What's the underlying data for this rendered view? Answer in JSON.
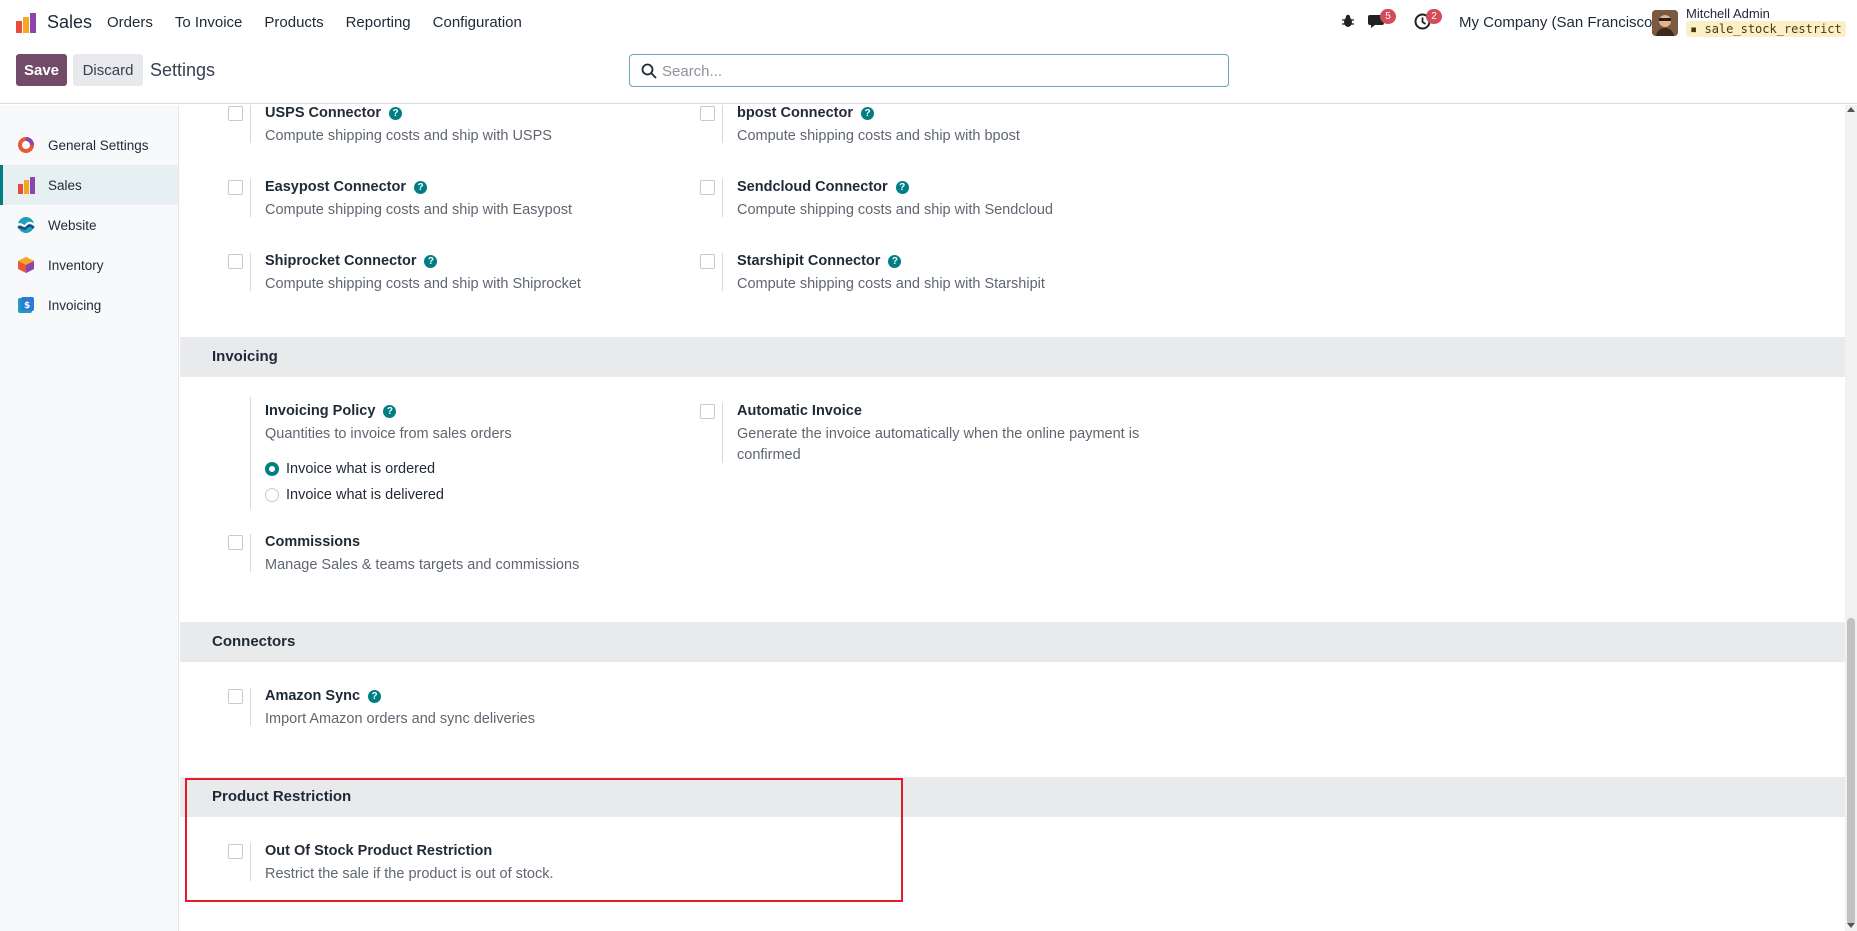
{
  "navbar": {
    "app_name": "Sales",
    "menu": [
      "Orders",
      "To Invoice",
      "Products",
      "Reporting",
      "Configuration"
    ],
    "messages_badge": "5",
    "activities_badge": "2",
    "company": "My Company (San Francisco)",
    "user_name": "Mitchell Admin",
    "db_name": "sale_stock_restrict"
  },
  "control": {
    "save_label": "Save",
    "discard_label": "Discard",
    "breadcrumb": "Settings",
    "search_placeholder": "Search..."
  },
  "sidebar": {
    "items": [
      {
        "label": "General Settings",
        "icon": "general-settings-icon"
      },
      {
        "label": "Sales",
        "icon": "sales-icon",
        "active": true
      },
      {
        "label": "Website",
        "icon": "website-icon"
      },
      {
        "label": "Inventory",
        "icon": "inventory-icon"
      },
      {
        "label": "Invoicing",
        "icon": "invoicing-icon"
      }
    ]
  },
  "shipping": {
    "usps": {
      "title": "USPS Connector",
      "desc": "Compute shipping costs and ship with USPS"
    },
    "bpost": {
      "title": "bpost Connector",
      "desc": "Compute shipping costs and ship with bpost"
    },
    "easypost": {
      "title": "Easypost Connector",
      "desc": "Compute shipping costs and ship with Easypost"
    },
    "sendcloud": {
      "title": "Sendcloud Connector",
      "desc": "Compute shipping costs and ship with Sendcloud"
    },
    "shiprocket": {
      "title": "Shiprocket Connector",
      "desc": "Compute shipping costs and ship with Shiprocket"
    },
    "starshipit": {
      "title": "Starshipit Connector",
      "desc": "Compute shipping costs and ship with Starshipit"
    }
  },
  "invoicing": {
    "heading": "Invoicing",
    "policy_title": "Invoicing Policy",
    "policy_desc": "Quantities to invoice from sales orders",
    "option_ordered": "Invoice what is ordered",
    "option_delivered": "Invoice what is delivered",
    "selected_option": "Invoice what is ordered",
    "auto_title": "Automatic Invoice",
    "auto_desc_1": "Generate the invoice automatically when the online payment is",
    "auto_desc_2": "confirmed",
    "commissions_title": "Commissions",
    "commissions_desc": "Manage Sales & teams targets and commissions"
  },
  "connectors": {
    "heading": "Connectors",
    "amazon_title": "Amazon Sync",
    "amazon_desc": "Import Amazon orders and sync deliveries"
  },
  "product_restriction": {
    "heading": "Product Restriction",
    "title": "Out Of Stock Product Restriction",
    "desc": "Restrict the sale if the product is out of stock."
  },
  "colors": {
    "brand": "#714b67",
    "accent": "#017e84",
    "highlight": "#e01e24",
    "badge": "#d44c59"
  }
}
